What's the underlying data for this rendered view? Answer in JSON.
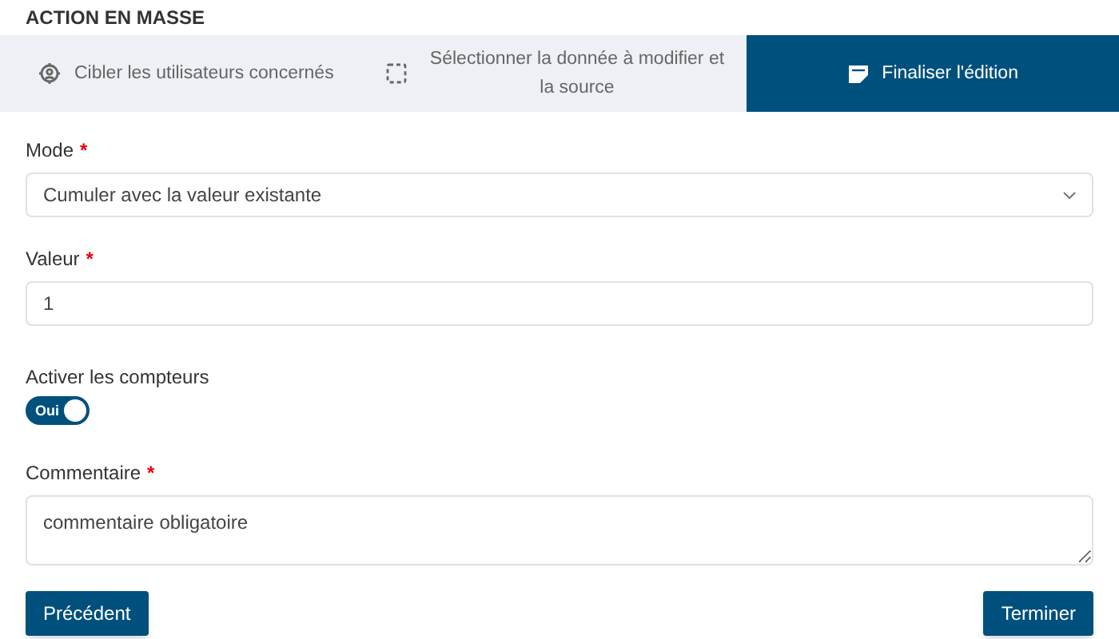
{
  "title": "ACTION EN MASSE",
  "tabs": [
    {
      "label": "Cibler les utilisateurs concernés",
      "selected": false
    },
    {
      "label": "Sélectionner la donnée à modifier et la source",
      "selected": false
    },
    {
      "label": "Finaliser l'édition",
      "selected": true
    }
  ],
  "mode": {
    "label": "Mode",
    "required_mark": "*",
    "value": "Cumuler avec la valeur existante"
  },
  "valeur": {
    "label": "Valeur",
    "required_mark": "*",
    "value": "1"
  },
  "counters": {
    "label": "Activer les compteurs",
    "toggle_text": "Oui",
    "on": true
  },
  "commentaire": {
    "label": "Commentaire",
    "required_mark": "*",
    "value": "commentaire obligatoire"
  },
  "buttons": [
    "Précédent",
    "Terminer"
  ]
}
